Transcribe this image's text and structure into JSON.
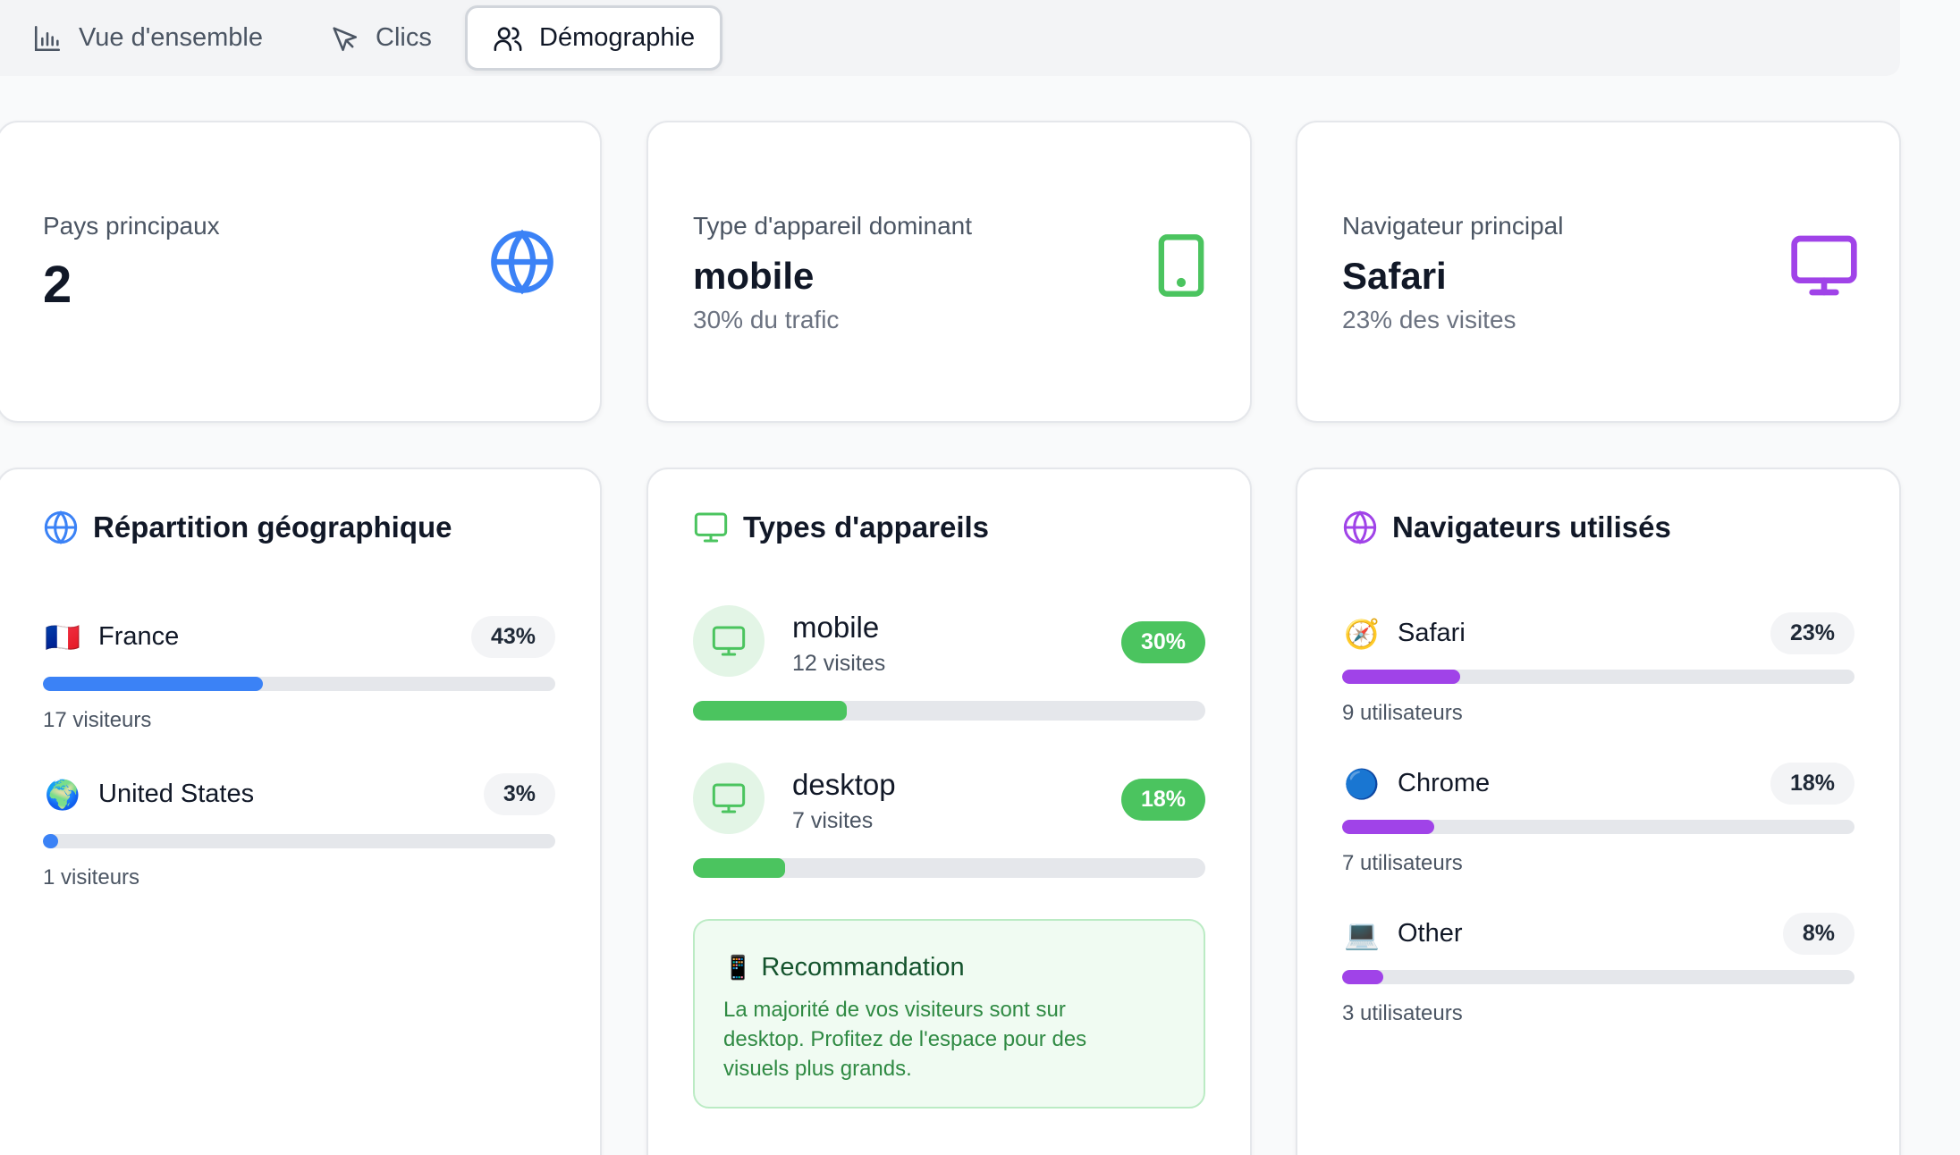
{
  "tabs": [
    {
      "label": "Vue d'ensemble",
      "icon": "bar-chart-icon"
    },
    {
      "label": "Clics",
      "icon": "cursor-icon"
    },
    {
      "label": "Démographie",
      "icon": "users-icon",
      "active": true
    }
  ],
  "summary": {
    "countries": {
      "label": "Pays principaux",
      "value": "2",
      "icon": "globe-icon",
      "color": "#3b82f6"
    },
    "device": {
      "label": "Type d'appareil dominant",
      "value": "mobile",
      "sub": "30% du trafic",
      "icon": "smartphone-icon",
      "color": "#4bc45f"
    },
    "browser": {
      "label": "Navigateur principal",
      "value": "Safari",
      "sub": "23% des visites",
      "icon": "monitor-icon",
      "color": "#a043e8"
    }
  },
  "geo": {
    "title": "Répartition géographique",
    "items": [
      {
        "flag": "🇫🇷",
        "name": "France",
        "percent": "43%",
        "ratio": 0.43,
        "sub": "17 visiteurs"
      },
      {
        "flag": "🌍",
        "name": "United States",
        "percent": "3%",
        "ratio": 0.03,
        "sub": "1 visiteurs"
      }
    ]
  },
  "devices": {
    "title": "Types d'appareils",
    "items": [
      {
        "name": "mobile",
        "visits": "12 visites",
        "percent": "30%",
        "ratio": 0.3
      },
      {
        "name": "desktop",
        "visits": "7 visites",
        "percent": "18%",
        "ratio": 0.18
      }
    ],
    "recommendation": {
      "icon": "📱",
      "title": "Recommandation",
      "text": "La majorité de vos visiteurs sont sur desktop. Profitez de l'espace pour des visuels plus grands."
    }
  },
  "browsers": {
    "title": "Navigateurs utilisés",
    "items": [
      {
        "icon": "🧭",
        "name": "Safari",
        "percent": "23%",
        "ratio": 0.23,
        "sub": "9 utilisateurs"
      },
      {
        "icon": "🔵",
        "name": "Chrome",
        "percent": "18%",
        "ratio": 0.18,
        "sub": "7 utilisateurs"
      },
      {
        "icon": "💻",
        "name": "Other",
        "percent": "8%",
        "ratio": 0.08,
        "sub": "3 utilisateurs"
      }
    ]
  }
}
